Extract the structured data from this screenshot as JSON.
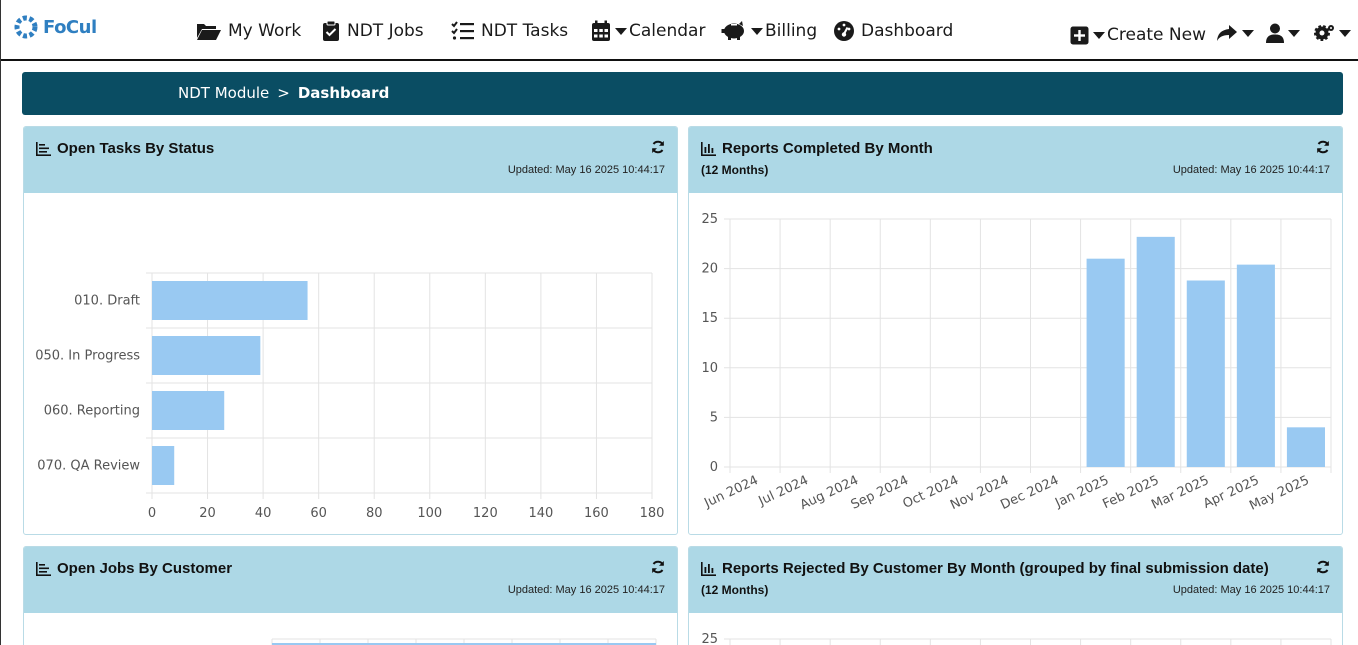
{
  "app": {
    "logo_text": "FoCul"
  },
  "nav": {
    "my_work": "My Work",
    "ndt_jobs": "NDT Jobs",
    "ndt_tasks": "NDT Tasks",
    "calendar": "Calendar",
    "billing": "Billing",
    "dashboard": "Dashboard",
    "create_new": "Create New"
  },
  "breadcrumb": {
    "root": "NDT Module",
    "separator": ">",
    "current": "Dashboard"
  },
  "panels": {
    "open_tasks": {
      "title": "Open Tasks By Status",
      "updated": "Updated: May 16 2025 10:44:17"
    },
    "reports_completed": {
      "title": "Reports Completed By Month",
      "subtitle": "(12 Months)",
      "updated": "Updated: May 16 2025 10:44:17"
    },
    "open_jobs": {
      "title": "Open Jobs By Customer",
      "updated": "Updated: May 16 2025 10:44:17"
    },
    "reports_rejected": {
      "title": "Reports Rejected By Customer By Month (grouped by final submission date)",
      "subtitle": "(12 Months)",
      "updated": "Updated: May 16 2025 10:44:17"
    }
  },
  "chart_data": [
    {
      "type": "bar",
      "orientation": "horizontal",
      "categories": [
        "010. Draft",
        "050. In Progress",
        "060. Reporting",
        "070. QA Review"
      ],
      "values": [
        56,
        39,
        26,
        8
      ],
      "xlim": [
        0,
        180
      ],
      "xticks": [
        0,
        20,
        40,
        60,
        80,
        100,
        120,
        140,
        160,
        180
      ],
      "grid": true,
      "bar_color": "#99c9f2"
    },
    {
      "type": "bar",
      "categories": [
        "Jun 2024",
        "Jul 2024",
        "Aug 2024",
        "Sep 2024",
        "Oct 2024",
        "Nov 2024",
        "Dec 2024",
        "Jan 2025",
        "Feb 2025",
        "Mar 2025",
        "Apr 2025",
        "May 2025"
      ],
      "values": [
        0,
        0,
        0,
        0,
        0,
        0,
        0,
        21,
        23.2,
        18.8,
        20.4,
        4
      ],
      "ylim": [
        0,
        25
      ],
      "yticks": [
        0,
        5,
        10,
        15,
        20,
        25
      ],
      "grid": true,
      "bar_color": "#99c9f2"
    },
    {
      "type": "bar",
      "orientation": "horizontal",
      "categories": [],
      "values": [],
      "grid": true
    },
    {
      "type": "bar",
      "categories": [],
      "values": [],
      "yticks": [
        25
      ],
      "grid": true
    }
  ]
}
